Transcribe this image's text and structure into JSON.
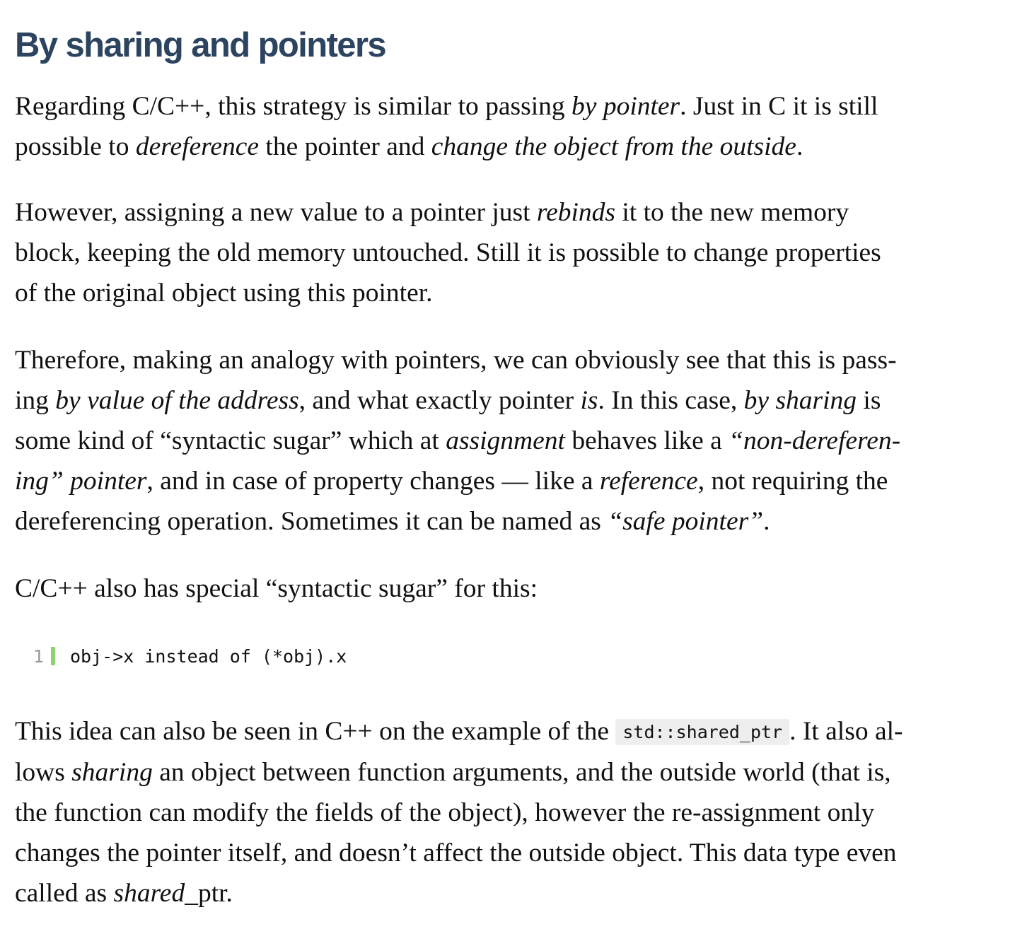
{
  "section": {
    "title": "By sharing and pointers"
  },
  "p1": {
    "l1a": "Regarding C/C++, this strategy is similar to passing ",
    "l1b": "by pointer",
    "l1c": ". Just in C it is still",
    "l2a": "possible to ",
    "l2b": "dereference",
    "l2c": " the pointer and ",
    "l2d": "change the object from the outside",
    "l2e": "."
  },
  "p2": {
    "l1a": "However, assigning a new value to a pointer just ",
    "l1b": "rebinds",
    "l1c": " it to the new memory",
    "l2": "block, keeping the old memory untouched. Still it is possible to change properties",
    "l3": "of the original object using this pointer."
  },
  "p3": {
    "l1": "Therefore, making an analogy with pointers, we can obviously see that this is pass-",
    "l2a": "ing ",
    "l2b": "by value of the address",
    "l2c": ", and what exactly pointer ",
    "l2d": "is",
    "l2e": ". In this case, ",
    "l2f": "by sharing",
    "l2g": " is",
    "l3a": "some kind of “syntactic sugar” which at ",
    "l3b": "assignment",
    "l3c": " behaves like a ",
    "l3d": "“non-dereferen-",
    "l4a": "ing” pointer",
    "l4b": ", and in case of property changes — like a ",
    "l4c": "reference",
    "l4d": ", not requiring the",
    "l5a": "dereferencing operation. Sometimes it can be named as ",
    "l5b": "“safe pointer”",
    "l5c": "."
  },
  "p4": {
    "text": "C/C++ also has special “syntactic sugar” for this:"
  },
  "code": {
    "line_number": "1",
    "line": "obj->x instead of (*obj).x"
  },
  "p5": {
    "l1a": "This idea can also be seen in C++ on the example of the ",
    "l1code": "std::shared_ptr",
    "l1b": ". It also al-",
    "l2a": "lows ",
    "l2b": "sharing",
    "l2c": " an object between function arguments, and the outside world (that is,",
    "l3": "the function can modify the fields of the object), however the re-assignment only",
    "l4": "changes the pointer itself, and doesn’t affect the outside object. This data type even",
    "l5a": "called as ",
    "l5b": "shared",
    "l5c": "_ptr."
  },
  "colors": {
    "heading": "#2c4460",
    "body_text": "#111111",
    "code_bar": "#8fd16f",
    "line_number": "#9a9a9a",
    "inline_code_bg": "#eeeeee"
  }
}
